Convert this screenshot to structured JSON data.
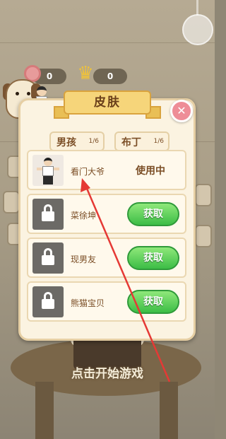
{
  "top_bar": {
    "candy_count": "0",
    "crown_count": "0"
  },
  "dialog": {
    "title": "皮肤",
    "close_label": "✕",
    "tabs": [
      {
        "label": "男孩",
        "count": "1/6"
      },
      {
        "label": "布丁",
        "count": "1/6"
      }
    ],
    "skins": [
      {
        "name": "看门大爷",
        "status": "使用中",
        "locked": false
      },
      {
        "name": "菜徐坤",
        "action": "获取",
        "locked": true
      },
      {
        "name": "现男友",
        "action": "获取",
        "locked": true
      },
      {
        "name": "熊猫宝贝",
        "action": "获取",
        "locked": true
      }
    ]
  },
  "background": {
    "start_label": "点击开始游戏"
  },
  "colors": {
    "accent_green": "#3cbd46",
    "close_pink": "#ee8d97",
    "banner_yellow": "#f6d57a",
    "annotation_red": "#e53935"
  }
}
